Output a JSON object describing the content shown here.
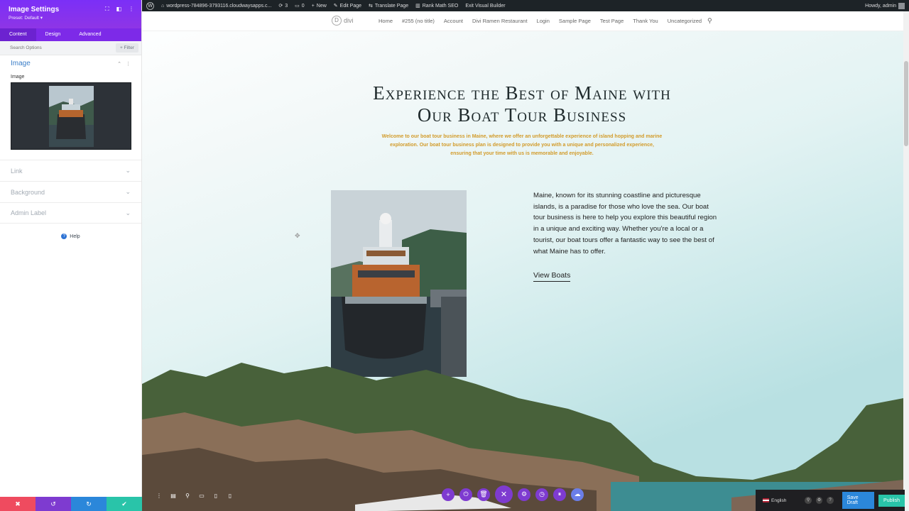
{
  "admin_bar": {
    "site": "wordpress-784896-3793116.cloudwaysapps.c...",
    "updates": "3",
    "comments": "0",
    "new": "New",
    "edit_page": "Edit Page",
    "translate": "Translate Page",
    "seo": "Rank Math SEO",
    "exit": "Exit Visual Builder",
    "howdy": "Howdy, admin"
  },
  "panel": {
    "title": "Image Settings",
    "preset": "Preset: Default",
    "tabs": [
      "Content",
      "Design",
      "Advanced"
    ],
    "search_placeholder": "Search Options",
    "filter": "Filter",
    "section": "Image",
    "field_label": "Image",
    "collapsed_sections": [
      "Link",
      "Background",
      "Admin Label"
    ],
    "help": "Help"
  },
  "site": {
    "logo": "divi",
    "nav": [
      "Home",
      "#255 (no title)",
      "Account",
      "Divi Ramen Restaurant",
      "Login",
      "Sample Page",
      "Test Page",
      "Thank You",
      "Uncategorized"
    ],
    "heading_line1": "Experience the Best of Maine with",
    "heading_line2": "Our Boat Tour Business",
    "intro": "Welcome to our boat tour business in Maine, where we offer an unforgettable experience of island hopping and marine exploration. Our boat tour business plan is designed to provide you with a unique and personalized experience, ensuring that your time with us is memorable and enjoyable.",
    "body": "Maine, known for its stunning coastline and picturesque islands, is a paradise for those who love the sea. Our boat tour business is here to help you explore this beautiful region in a unique and exciting way. Whether you're a local or a tourist, our boat tours offer a fantastic way to see the best of what Maine has to offer.",
    "cta": "View Boats"
  },
  "builder": {
    "language": "English",
    "save_draft": "Save Draft",
    "publish": "Publish"
  },
  "colors": {
    "purple": "#7d2ae8",
    "accent_text": "#d29b2a",
    "blue": "#2b87da",
    "teal": "#29c4a9"
  }
}
